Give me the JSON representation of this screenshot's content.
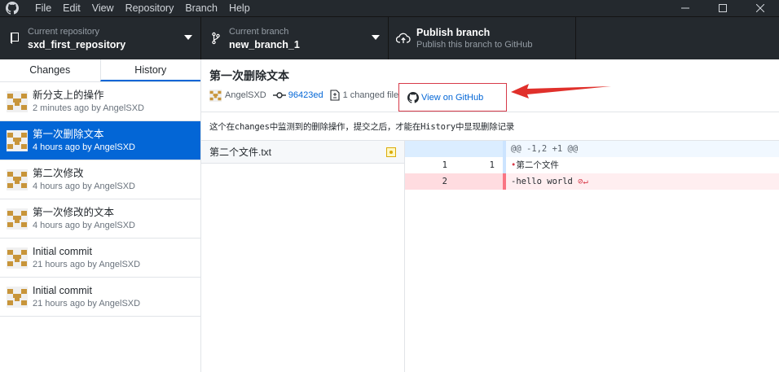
{
  "menu": [
    "File",
    "Edit",
    "View",
    "Repository",
    "Branch",
    "Help"
  ],
  "toolbar": {
    "repo_label": "Current repository",
    "repo_value": "sxd_first_repository",
    "branch_label": "Current branch",
    "branch_value": "new_branch_1",
    "publish_title": "Publish branch",
    "publish_sub": "Publish this branch to GitHub"
  },
  "tabs": {
    "changes": "Changes",
    "history": "History"
  },
  "commits": [
    {
      "title": "新分支上的操作",
      "meta": "2 minutes ago by AngelSXD"
    },
    {
      "title": "第一次删除文本",
      "meta": "4 hours ago by AngelSXD"
    },
    {
      "title": "第二次修改",
      "meta": "4 hours ago by AngelSXD"
    },
    {
      "title": "第一次修改的文本",
      "meta": "4 hours ago by AngelSXD"
    },
    {
      "title": "Initial commit",
      "meta": "21 hours ago by AngelSXD"
    },
    {
      "title": "Initial commit",
      "meta": "21 hours ago by AngelSXD"
    }
  ],
  "detail": {
    "title": "第一次删除文本",
    "author": "AngelSXD",
    "sha": "96423ed",
    "changed": "1 changed file",
    "view_on_github": "View on GitHub",
    "description": "这个在changes中监测到的删除操作，提交之后，才能在History中显现删除记录"
  },
  "files": [
    {
      "name": "第二个文件.txt",
      "status": "modified"
    }
  ],
  "diff": {
    "hunk": "@@ -1,2 +1 @@",
    "line1_old": "1",
    "line1_new": "1",
    "line1_text": "第二个文件",
    "line2_old": "2",
    "line2_text": "-hello world"
  },
  "colors": {
    "accent": "#0366d6",
    "highlight_box": "#d73a49",
    "arrow": "#e0302b"
  }
}
